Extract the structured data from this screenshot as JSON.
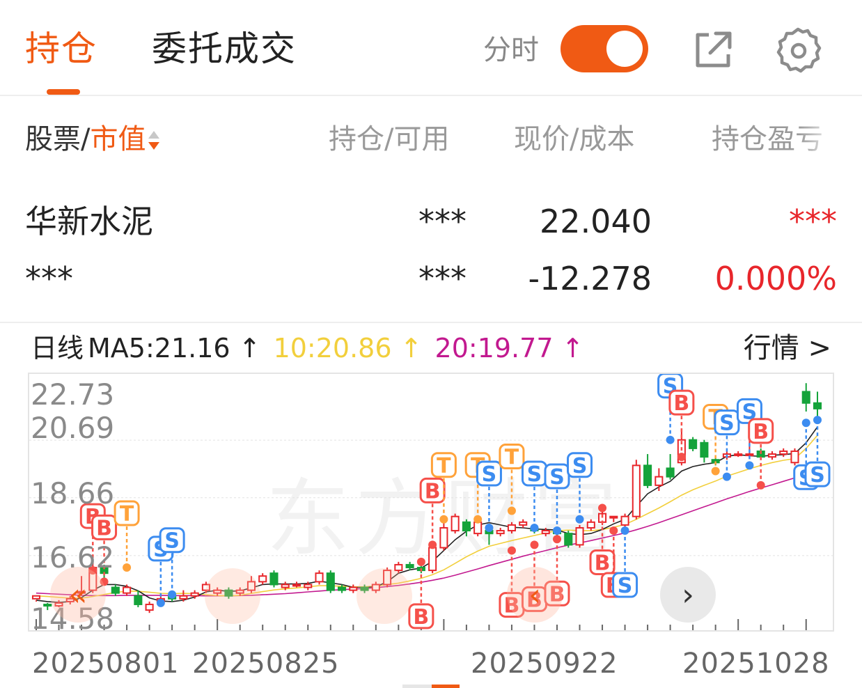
{
  "tabs": [
    {
      "label": "持仓",
      "active": true
    },
    {
      "label": "委托成交",
      "active": false
    }
  ],
  "toggle": {
    "label": "分时",
    "on": true
  },
  "icons": {
    "share": "share-external-icon",
    "settings": "gear-icon"
  },
  "columns": {
    "stock": "股票",
    "slash": "/",
    "market_value": "市值",
    "hold": "持仓/可用",
    "price": "现价/成本",
    "pl": "持仓盈亏"
  },
  "position": {
    "name": "华新水泥",
    "market_value": "***",
    "hold": "***",
    "available": "***",
    "price": "22.040",
    "cost": "-12.278",
    "pl": "***",
    "pl_pct": "0.000%"
  },
  "ma": {
    "label": "日线",
    "ma5": "MA5:21.16 ↑",
    "ma10": "10:20.86 ↑",
    "ma20": "20:19.77 ↑",
    "quote_link": "行情 >"
  },
  "colors": {
    "accent": "#f05a14",
    "up": "#e8262b",
    "down": "#14a33a",
    "ma5": "#222222",
    "ma10": "#f2cf3c",
    "ma20": "#c2198f",
    "buy": "#f5504a",
    "sell": "#3c8cf0",
    "t": "#ffa23a"
  },
  "chart_data": {
    "type": "candlestick",
    "y_ticks": [
      "22.73",
      "20.69",
      "18.66",
      "16.62",
      "14.58"
    ],
    "ylim": [
      14.58,
      22.73
    ],
    "x_ticks": [
      "20250801",
      "20250825",
      "20250922",
      "20251028"
    ],
    "watermark": "东方财富",
    "candles": [
      [
        15.1,
        15.2,
        15.0,
        15.05
      ],
      [
        14.9,
        14.85,
        14.7,
        14.95
      ],
      [
        14.85,
        14.95,
        14.8,
        15.05
      ],
      [
        15.0,
        15.1,
        14.9,
        15.2
      ],
      [
        15.3,
        15.35,
        15.2,
        15.9
      ],
      [
        15.4,
        16.2,
        15.3,
        16.4
      ],
      [
        16.2,
        16.0,
        15.8,
        16.3
      ],
      [
        15.5,
        15.3,
        15.2,
        15.6
      ],
      [
        15.3,
        15.5,
        15.2,
        15.6
      ],
      [
        15.2,
        14.9,
        14.8,
        15.4
      ],
      [
        14.7,
        14.9,
        14.6,
        15.0
      ],
      [
        15.0,
        15.1,
        14.9,
        15.2
      ],
      [
        15.2,
        15.1,
        15.0,
        15.3
      ],
      [
        15.1,
        15.2,
        15.0,
        15.4
      ],
      [
        15.2,
        15.3,
        15.1,
        15.4
      ],
      [
        15.4,
        15.6,
        15.3,
        15.7
      ],
      [
        15.3,
        15.4,
        15.2,
        15.5
      ],
      [
        15.4,
        15.2,
        15.1,
        15.5
      ],
      [
        15.3,
        15.4,
        15.2,
        15.5
      ],
      [
        15.4,
        15.7,
        15.3,
        15.9
      ],
      [
        15.7,
        15.9,
        15.6,
        16.0
      ],
      [
        16.0,
        15.6,
        15.5,
        16.1
      ],
      [
        15.5,
        15.6,
        15.4,
        15.7
      ],
      [
        15.6,
        15.6,
        15.5,
        15.7
      ],
      [
        15.5,
        15.6,
        15.4,
        15.7
      ],
      [
        15.7,
        16.0,
        15.6,
        16.1
      ],
      [
        16.0,
        15.4,
        15.3,
        16.1
      ],
      [
        15.5,
        15.4,
        15.3,
        15.6
      ],
      [
        15.4,
        15.5,
        15.3,
        15.6
      ],
      [
        15.5,
        15.4,
        15.3,
        15.6
      ],
      [
        15.4,
        15.6,
        15.3,
        15.7
      ],
      [
        15.6,
        16.1,
        15.5,
        16.2
      ],
      [
        16.1,
        16.3,
        16.0,
        16.4
      ],
      [
        16.3,
        16.2,
        16.1,
        16.4
      ],
      [
        16.2,
        16.1,
        16.0,
        16.3
      ],
      [
        16.1,
        16.9,
        16.0,
        17.0
      ],
      [
        16.9,
        17.6,
        16.8,
        17.8
      ],
      [
        17.5,
        18.0,
        17.4,
        18.1
      ],
      [
        17.8,
        17.5,
        17.3,
        17.9
      ],
      [
        17.4,
        17.8,
        17.3,
        17.9
      ],
      [
        17.5,
        17.4,
        17.0,
        17.7
      ],
      [
        17.4,
        17.5,
        17.3,
        17.6
      ],
      [
        17.5,
        17.7,
        17.4,
        17.8
      ],
      [
        17.7,
        17.8,
        17.6,
        17.9
      ],
      [
        17.6,
        17.5,
        17.4,
        17.7
      ],
      [
        17.4,
        17.5,
        17.3,
        17.6
      ],
      [
        17.5,
        17.4,
        17.2,
        17.6
      ],
      [
        17.4,
        17.0,
        16.9,
        17.5
      ],
      [
        17.0,
        17.6,
        16.9,
        17.7
      ],
      [
        17.6,
        17.8,
        17.5,
        17.9
      ],
      [
        17.8,
        18.1,
        17.7,
        18.2
      ],
      [
        18.0,
        18.0,
        17.8,
        18.0
      ],
      [
        17.7,
        18.0,
        17.4,
        18.1
      ],
      [
        18.0,
        19.8,
        17.9,
        20.0
      ],
      [
        19.8,
        19.1,
        19.0,
        20.2
      ],
      [
        19.1,
        19.4,
        18.9,
        19.7
      ],
      [
        19.7,
        19.4,
        19.3,
        20.2
      ],
      [
        19.9,
        20.7,
        19.8,
        21.1
      ],
      [
        20.7,
        20.4,
        20.3,
        20.8
      ],
      [
        20.6,
        20.1,
        19.9,
        20.7
      ],
      [
        20.0,
        19.9,
        19.8,
        20.1
      ],
      [
        20.1,
        20.2,
        20.0,
        20.3
      ],
      [
        20.2,
        20.2,
        20.1,
        20.3
      ],
      [
        20.2,
        20.2,
        20.1,
        20.9
      ],
      [
        20.3,
        20.1,
        20.0,
        20.4
      ],
      [
        20.1,
        20.2,
        20.0,
        20.3
      ],
      [
        20.2,
        20.3,
        20.1,
        20.4
      ],
      [
        19.9,
        20.3,
        19.8,
        20.4
      ],
      [
        22.4,
        22.0,
        21.7,
        22.7
      ],
      [
        22.0,
        21.8,
        21.5,
        22.4
      ]
    ],
    "ma5": [
      15.05,
      15.0,
      14.97,
      15.0,
      15.14,
      15.4,
      15.6,
      15.6,
      15.54,
      15.38,
      15.13,
      15.02,
      15.0,
      15.05,
      15.16,
      15.34,
      15.4,
      15.36,
      15.38,
      15.48,
      15.6,
      15.62,
      15.62,
      15.62,
      15.64,
      15.72,
      15.66,
      15.6,
      15.5,
      15.5,
      15.52,
      15.7,
      16.0,
      16.12,
      16.18,
      16.42,
      16.8,
      17.18,
      17.48,
      17.7,
      17.78,
      17.7,
      17.62,
      17.6,
      17.56,
      17.54,
      17.52,
      17.4,
      17.36,
      17.4,
      17.54,
      17.74,
      17.9,
      18.36,
      18.8,
      19.04,
      19.24,
      19.6,
      19.76,
      19.84,
      19.9,
      20.12,
      20.18,
      20.14,
      20.12,
      20.16,
      20.18,
      20.22,
      20.6,
      21.16
    ],
    "ma10": [
      15.2,
      15.18,
      15.15,
      15.12,
      15.12,
      15.18,
      15.25,
      15.32,
      15.37,
      15.36,
      15.33,
      15.29,
      15.28,
      15.29,
      15.28,
      15.24,
      15.21,
      15.2,
      15.22,
      15.29,
      15.35,
      15.41,
      15.45,
      15.48,
      15.52,
      15.56,
      15.56,
      15.54,
      15.52,
      15.52,
      15.55,
      15.6,
      15.65,
      15.73,
      15.82,
      15.95,
      16.12,
      16.35,
      16.58,
      16.78,
      16.95,
      17.05,
      17.15,
      17.24,
      17.33,
      17.42,
      17.5,
      17.52,
      17.5,
      17.5,
      17.54,
      17.62,
      17.72,
      17.9,
      18.1,
      18.3,
      18.52,
      18.75,
      18.94,
      19.1,
      19.25,
      19.42,
      19.55,
      19.68,
      19.8,
      19.9,
      19.98,
      20.04,
      20.4,
      20.86
    ],
    "ma20": [
      15.3,
      15.28,
      15.26,
      15.24,
      15.22,
      15.21,
      15.21,
      15.21,
      15.22,
      15.22,
      15.22,
      15.22,
      15.21,
      15.21,
      15.21,
      15.2,
      15.2,
      15.2,
      15.21,
      15.22,
      15.24,
      15.26,
      15.28,
      15.31,
      15.34,
      15.37,
      15.4,
      15.42,
      15.44,
      15.46,
      15.49,
      15.53,
      15.57,
      15.62,
      15.68,
      15.75,
      15.83,
      15.93,
      16.04,
      16.15,
      16.27,
      16.38,
      16.49,
      16.6,
      16.7,
      16.8,
      16.9,
      16.99,
      17.07,
      17.15,
      17.24,
      17.33,
      17.42,
      17.53,
      17.65,
      17.78,
      17.92,
      18.06,
      18.2,
      18.34,
      18.48,
      18.62,
      18.75,
      18.88,
      19.0,
      19.12,
      19.24,
      19.36,
      19.57,
      19.77
    ],
    "markers": [
      {
        "i": 5,
        "type": "B",
        "side": "up",
        "v": 16.1
      },
      {
        "i": 6,
        "type": "B",
        "side": "up",
        "v": 15.7
      },
      {
        "i": 8,
        "type": "T",
        "side": "up",
        "v": 16.2
      },
      {
        "i": 11,
        "type": "S",
        "side": "up",
        "v": 14.95
      },
      {
        "i": 12,
        "type": "S",
        "side": "up",
        "v": 15.25
      },
      {
        "i": 35,
        "type": "B",
        "side": "up",
        "v": 17.0
      },
      {
        "i": 36,
        "type": "T",
        "side": "up",
        "v": 17.9
      },
      {
        "i": 39,
        "type": "T",
        "side": "up",
        "v": 17.9
      },
      {
        "i": 40,
        "type": "S",
        "side": "up",
        "v": 17.6
      },
      {
        "i": 42,
        "type": "T",
        "side": "up",
        "v": 18.2
      },
      {
        "i": 44,
        "type": "S",
        "side": "up",
        "v": 17.6
      },
      {
        "i": 46,
        "type": "S",
        "side": "up",
        "v": 17.5
      },
      {
        "i": 48,
        "type": "S",
        "side": "up",
        "v": 17.9
      },
      {
        "i": 34,
        "type": "B",
        "side": "down",
        "v": 16.4
      },
      {
        "i": 42,
        "type": "B",
        "side": "down",
        "v": 16.8
      },
      {
        "i": 44,
        "type": "B",
        "side": "down",
        "v": 17.0
      },
      {
        "i": 46,
        "type": "B",
        "side": "down",
        "v": 17.2
      },
      {
        "i": 50,
        "type": "B",
        "side": "down",
        "v": 18.3
      },
      {
        "i": 51,
        "type": "B",
        "side": "down",
        "v": 17.5
      },
      {
        "i": 52,
        "type": "S",
        "side": "down",
        "v": 17.5
      },
      {
        "i": 56,
        "type": "S",
        "side": "up",
        "v": 20.7
      },
      {
        "i": 57,
        "type": "B",
        "side": "up",
        "v": 20.1
      },
      {
        "i": 60,
        "type": "T",
        "side": "up",
        "v": 19.6
      },
      {
        "i": 61,
        "type": "S",
        "side": "up",
        "v": 19.4
      },
      {
        "i": 63,
        "type": "S",
        "side": "up",
        "v": 19.8
      },
      {
        "i": 64,
        "type": "B",
        "side": "up",
        "v": 19.1
      },
      {
        "i": 68,
        "type": "S",
        "side": "down",
        "v": 21.3
      },
      {
        "i": 69,
        "type": "S",
        "side": "down",
        "v": 21.4
      }
    ]
  }
}
